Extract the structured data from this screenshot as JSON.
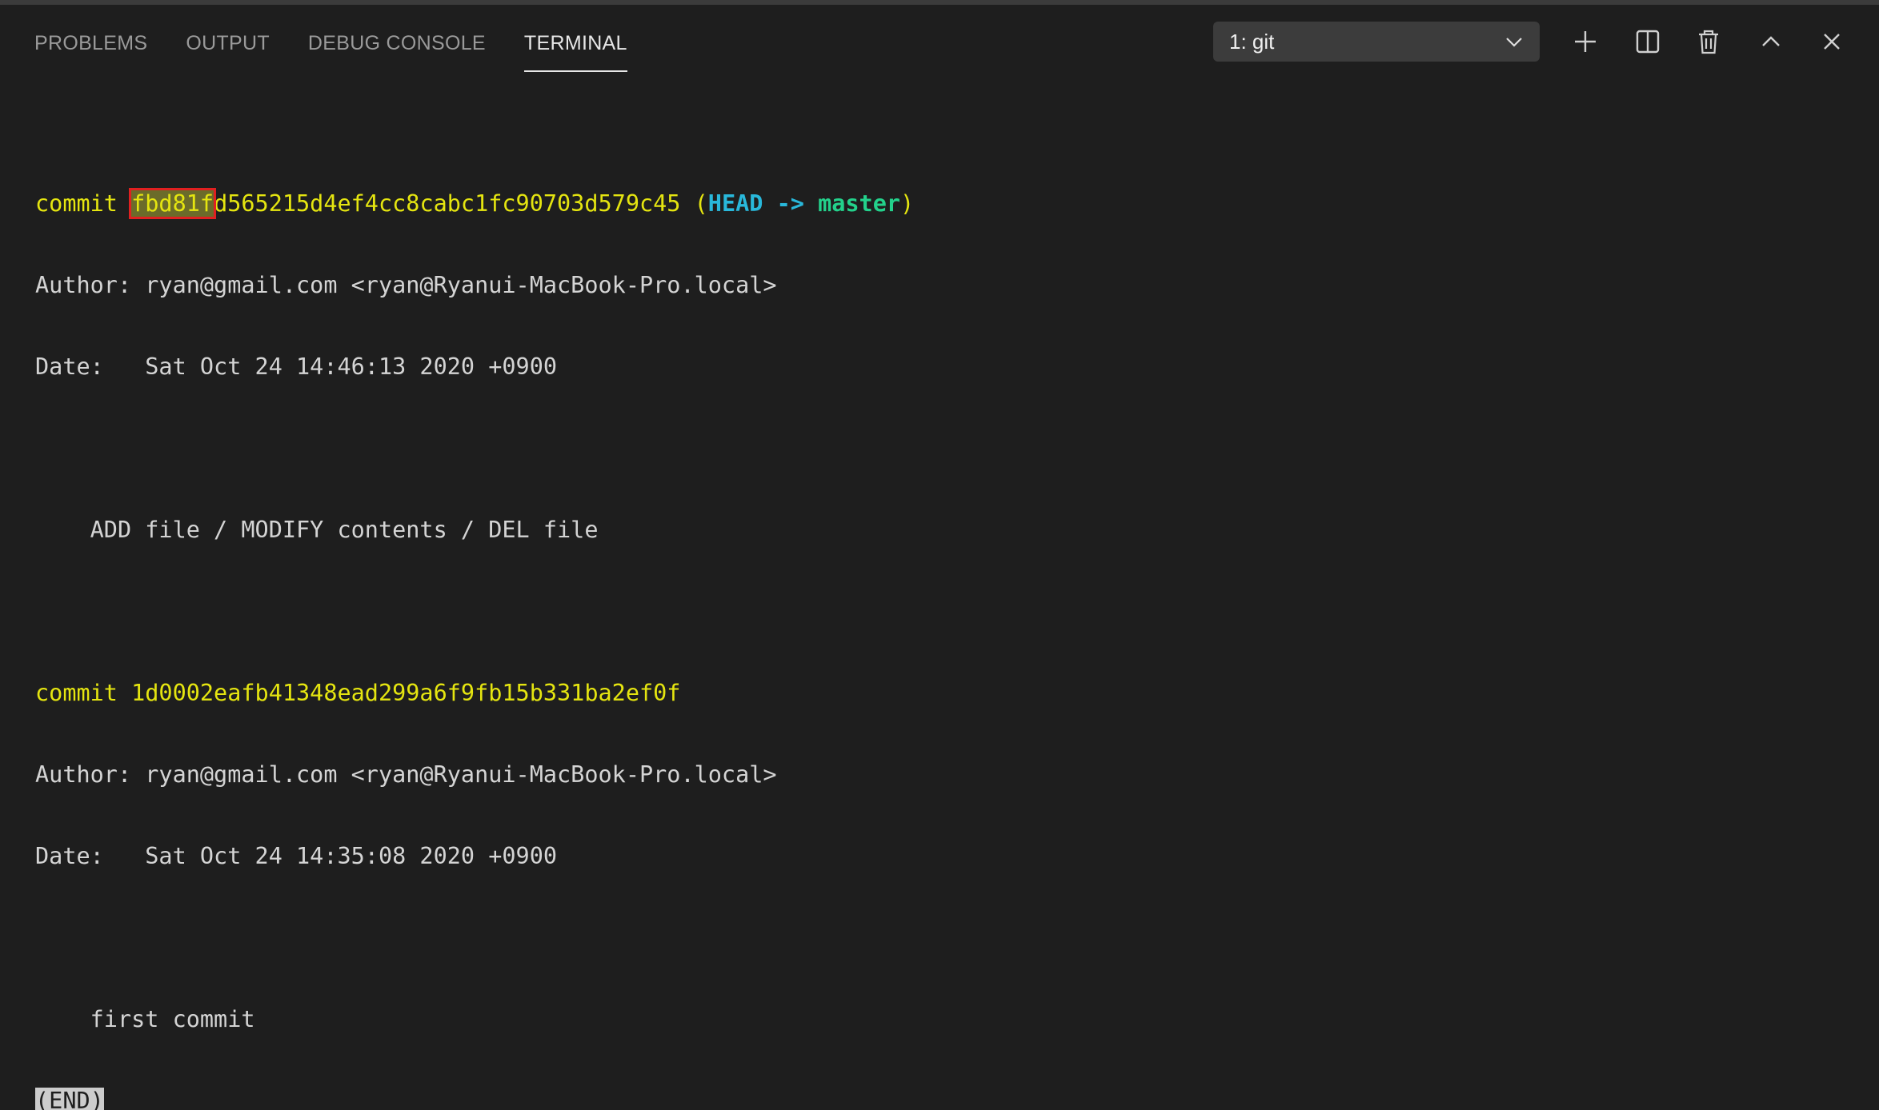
{
  "tabs": [
    {
      "label": "PROBLEMS"
    },
    {
      "label": "OUTPUT"
    },
    {
      "label": "DEBUG CONSOLE"
    },
    {
      "label": "TERMINAL"
    }
  ],
  "active_tab": "TERMINAL",
  "terminal_select": {
    "value": "1: git"
  },
  "toolbar_icons": [
    "plus-icon",
    "split-icon",
    "trash-icon",
    "chevron-up-icon",
    "close-icon"
  ],
  "terminal": {
    "commit1": {
      "prefix": "commit ",
      "hash_highlight": "fbd81f",
      "hash_rest": "d565215d4ef4cc8cabc1fc90703d579c45",
      "paren_open": " (",
      "head": "HEAD -> ",
      "branch": "master",
      "paren_close": ")",
      "author": "Author: ryan@gmail.com <ryan@Ryanui-MacBook-Pro.local>",
      "date": "Date:   Sat Oct 24 14:46:13 2020 +0900",
      "message": "    ADD file / MODIFY contents / DEL file"
    },
    "commit2": {
      "line": "commit 1d0002eafb41348ead299a6f9fb15b331ba2ef0f",
      "author": "Author: ryan@gmail.com <ryan@Ryanui-MacBook-Pro.local>",
      "date": "Date:   Sat Oct 24 14:35:08 2020 +0900",
      "message": "    first commit"
    },
    "end_marker": "(END)"
  },
  "colors": {
    "background": "#1e1e1e",
    "yellow": "#e5e510",
    "cyan": "#29b8db",
    "green": "#23d18b",
    "highlight_border": "#e02020"
  }
}
